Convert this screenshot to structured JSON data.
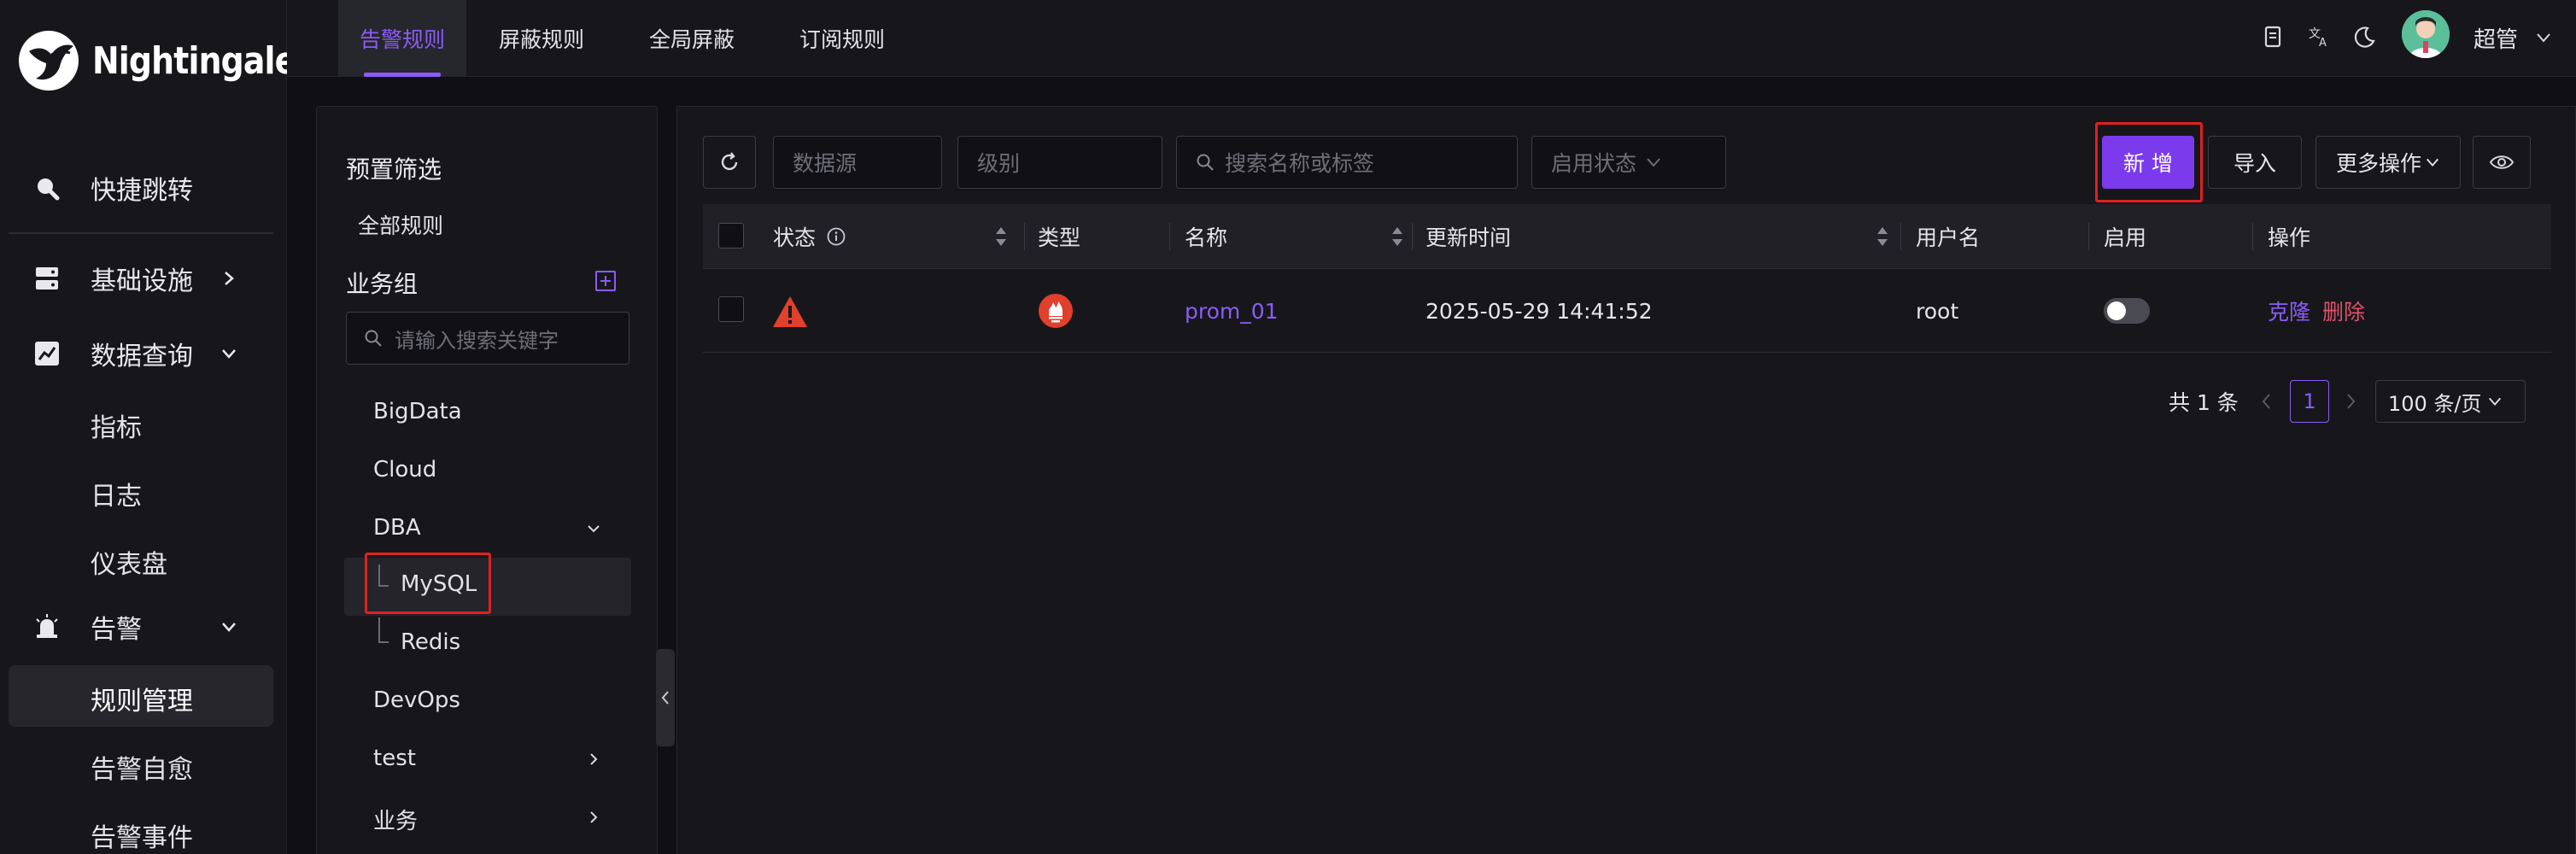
{
  "brand": {
    "name": "Nightingale"
  },
  "colors": {
    "accent": "#8b5cf6",
    "primary_button": "#7c3aed",
    "danger": "#e0506a",
    "alert_icon": "#e0402c",
    "highlight_box": "#e02020"
  },
  "nav": {
    "quick_jump": "快捷跳转",
    "infrastructure": "基础设施",
    "data_query": "数据查询",
    "metrics": "指标",
    "logs": "日志",
    "dashboards": "仪表盘",
    "alerting": "告警",
    "rule_management": "规则管理",
    "self_healing": "告警自愈",
    "alert_events": "告警事件"
  },
  "tabs": [
    {
      "label": "告警规则",
      "active": true
    },
    {
      "label": "屏蔽规则",
      "active": false
    },
    {
      "label": "全局屏蔽",
      "active": false
    },
    {
      "label": "订阅规则",
      "active": false
    }
  ],
  "header": {
    "user": "超管",
    "icons": [
      "doc-icon",
      "translate-icon",
      "moon-icon"
    ]
  },
  "left_panel": {
    "preset_filter": "预置筛选",
    "all_rules": "全部规则",
    "business_group": "业务组",
    "search_placeholder": "请输入搜索关键字",
    "groups": [
      "BigData",
      "Cloud",
      "DBA",
      "MySQL",
      "Redis",
      "DevOps",
      "test",
      "业务"
    ]
  },
  "toolbar": {
    "datasource_placeholder": "数据源",
    "level_placeholder": "级别",
    "search_placeholder": "搜索名称或标签",
    "enable_status_placeholder": "启用状态",
    "new_button": "新 增",
    "import_button": "导入",
    "more_button": "更多操作"
  },
  "table": {
    "columns": [
      "状态",
      "类型",
      "名称",
      "更新时间",
      "用户名",
      "启用",
      "操作"
    ],
    "rows": [
      {
        "status": "warning",
        "type": "prometheus",
        "name": "prom_01",
        "updated": "2025-05-29 14:41:52",
        "user": "root",
        "enabled": false,
        "actions": [
          "克隆",
          "删除"
        ]
      }
    ]
  },
  "pagination": {
    "total": "共 1 条",
    "current_page": "1",
    "page_size": "100 条/页"
  }
}
